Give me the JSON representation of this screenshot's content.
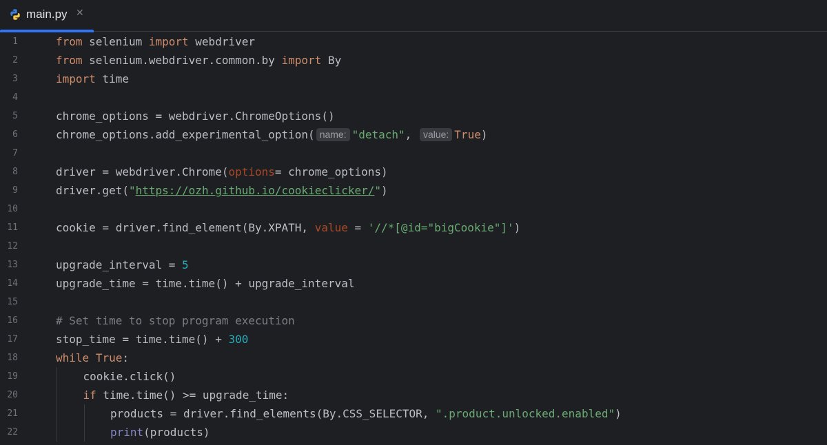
{
  "tab": {
    "filename": "main.py",
    "close_glyph": "✕",
    "icon": "python-icon"
  },
  "colors": {
    "background": "#1e1f22",
    "keyword": "#cf8e6d",
    "string": "#6aab73",
    "number": "#2aacb8",
    "comment": "#7a7e85",
    "named_arg": "#aa4926",
    "builtin": "#8888c6",
    "tab_accent": "#3574f0"
  },
  "lines": [
    {
      "n": "1",
      "indent": 0,
      "tokens": [
        [
          "kw",
          "from"
        ],
        [
          "t",
          " selenium "
        ],
        [
          "kw",
          "import"
        ],
        [
          "t",
          " webdriver"
        ]
      ]
    },
    {
      "n": "2",
      "indent": 0,
      "tokens": [
        [
          "kw",
          "from"
        ],
        [
          "t",
          " selenium.webdriver.common.by "
        ],
        [
          "kw",
          "import"
        ],
        [
          "t",
          " By"
        ]
      ]
    },
    {
      "n": "3",
      "indent": 0,
      "tokens": [
        [
          "kw",
          "import"
        ],
        [
          "t",
          " time"
        ]
      ]
    },
    {
      "n": "4",
      "indent": 0,
      "tokens": []
    },
    {
      "n": "5",
      "indent": 0,
      "tokens": [
        [
          "t",
          "chrome_options = webdriver.ChromeOptions()"
        ]
      ]
    },
    {
      "n": "6",
      "indent": 0,
      "tokens": [
        [
          "t",
          "chrome_options.add_experimental_option("
        ],
        [
          "hint",
          "name:"
        ],
        [
          "str",
          "\"detach\""
        ],
        [
          "t",
          ", "
        ],
        [
          "hint",
          "value:"
        ],
        [
          "kw",
          "True"
        ],
        [
          "t",
          ")"
        ]
      ]
    },
    {
      "n": "7",
      "indent": 0,
      "tokens": []
    },
    {
      "n": "8",
      "indent": 0,
      "tokens": [
        [
          "t",
          "driver = webdriver.Chrome("
        ],
        [
          "named",
          "options"
        ],
        [
          "t",
          "= chrome_options)"
        ]
      ]
    },
    {
      "n": "9",
      "indent": 0,
      "tokens": [
        [
          "t",
          "driver.get("
        ],
        [
          "str",
          "\""
        ],
        [
          "url",
          "https://ozh.github.io/cookieclicker/"
        ],
        [
          "str",
          "\""
        ],
        [
          "t",
          ")"
        ]
      ]
    },
    {
      "n": "10",
      "indent": 0,
      "tokens": []
    },
    {
      "n": "11",
      "indent": 0,
      "tokens": [
        [
          "t",
          "cookie = driver.find_element(By.XPATH, "
        ],
        [
          "named",
          "value"
        ],
        [
          "t",
          " = "
        ],
        [
          "str",
          "'//*[@id=\"bigCookie\"]'"
        ],
        [
          "t",
          ")"
        ]
      ]
    },
    {
      "n": "12",
      "indent": 0,
      "tokens": []
    },
    {
      "n": "13",
      "indent": 0,
      "tokens": [
        [
          "t",
          "upgrade_interval = "
        ],
        [
          "num",
          "5"
        ]
      ]
    },
    {
      "n": "14",
      "indent": 0,
      "tokens": [
        [
          "t",
          "upgrade_time = time.time() + upgrade_interval"
        ]
      ]
    },
    {
      "n": "15",
      "indent": 0,
      "tokens": []
    },
    {
      "n": "16",
      "indent": 0,
      "tokens": [
        [
          "cmt",
          "# Set time to stop program execution"
        ]
      ]
    },
    {
      "n": "17",
      "indent": 0,
      "tokens": [
        [
          "t",
          "stop_time = time.time() + "
        ],
        [
          "num",
          "300"
        ]
      ]
    },
    {
      "n": "18",
      "indent": 0,
      "tokens": [
        [
          "kw",
          "while"
        ],
        [
          "t",
          " "
        ],
        [
          "kw",
          "True"
        ],
        [
          "t",
          ":"
        ]
      ]
    },
    {
      "n": "19",
      "indent": 1,
      "tokens": [
        [
          "t",
          "cookie.click()"
        ]
      ]
    },
    {
      "n": "20",
      "indent": 1,
      "tokens": [
        [
          "kw",
          "if"
        ],
        [
          "t",
          " time.time() >= upgrade_time:"
        ]
      ]
    },
    {
      "n": "21",
      "indent": 2,
      "tokens": [
        [
          "t",
          "products = driver.find_elements(By.CSS_SELECTOR, "
        ],
        [
          "str",
          "\".product.unlocked.enabled\""
        ],
        [
          "t",
          ")"
        ]
      ]
    },
    {
      "n": "22",
      "indent": 2,
      "tokens": [
        [
          "builtin",
          "print"
        ],
        [
          "t",
          "(products)"
        ]
      ]
    }
  ]
}
